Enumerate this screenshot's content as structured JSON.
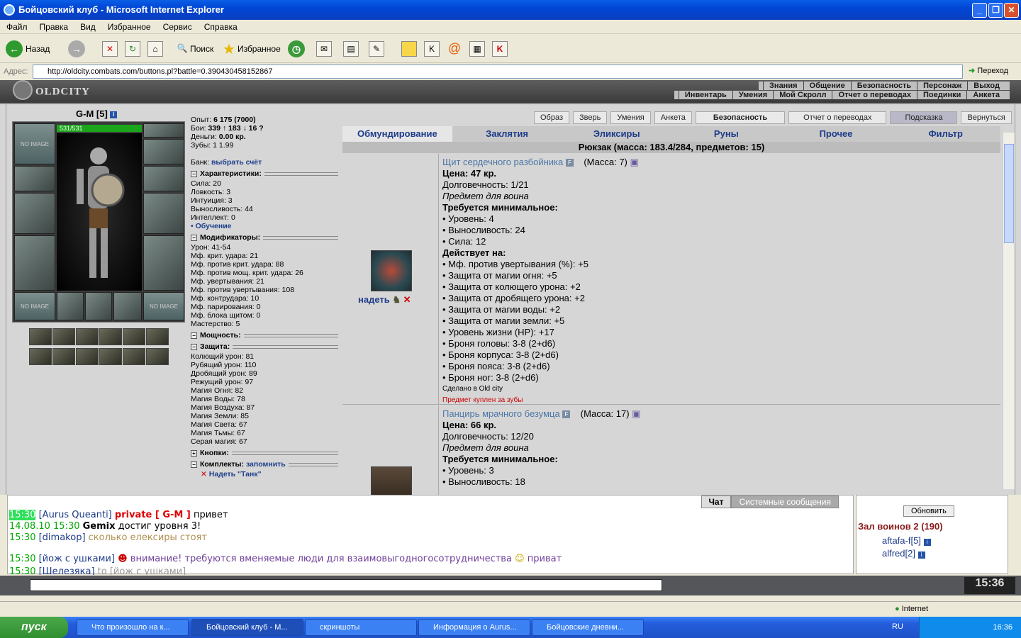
{
  "window": {
    "title": "Бойцовский клуб - Microsoft Internet Explorer"
  },
  "menu": [
    "Файл",
    "Правка",
    "Вид",
    "Избранное",
    "Сервис",
    "Справка"
  ],
  "toolbar": {
    "back": "Назад",
    "search": "Поиск",
    "favorites": "Избранное"
  },
  "address": {
    "label": "Адрес:",
    "url": "http://oldcity.combats.com/buttons.pl?battle=0.390430458152867",
    "go": "Переход"
  },
  "game": {
    "logo": "OLDCITY",
    "topnav1": [
      "Знания",
      "Общение",
      "Безопасность",
      "Персонаж",
      "Выход"
    ],
    "topnav2": [
      "Инвентарь",
      "Умения",
      "Мой Скролл",
      "Отчет о переводах",
      "Поединки",
      "Анкета"
    ],
    "char": {
      "name": "G-M [5]",
      "hp": "531/531",
      "noimage": "NO IMAGE"
    },
    "stats": {
      "exp_label": "Опыт:",
      "exp": "6 175 (7000)",
      "fights_label": "Бои:",
      "fights": "339 ↑  183 ↓  16 ?",
      "money_label": "Деньги:",
      "money": "0.00 кр.",
      "teeth_label": "Зубы:",
      "teeth": "1  1.99",
      "bank_label": "Банк:",
      "bank": "выбрать счёт",
      "chars_head": "Характеристики:",
      "chars": [
        "Сила: 20",
        "Ловкость: 3",
        "Интуиция: 3",
        "Выносливость: 44",
        "Интеллект: 0"
      ],
      "training": "• Обучение",
      "mods_head": "Модификаторы:",
      "mods": [
        "Урон: 41-54",
        "Мф. крит. удара: 21",
        "Мф. против крит. удара: 88",
        "Мф. против мощ. крит. удара: 26",
        "Мф. увертывания: 21",
        "Мф. против увертывания: 108",
        "Мф. контрудара: 10",
        "Мф. парирования: 0",
        "Мф. блока щитом: 0",
        "Мастерство: 5"
      ],
      "power_head": "Мощность:",
      "prot_head": "Защита:",
      "prot": [
        "Колющий урон: 81",
        "Рубящий урон: 110",
        "Дробящий урон: 89",
        "Режущий урон: 97",
        "Магия Огня: 82",
        "Магия Воды: 78",
        "Магия Воздуха: 87",
        "Магия Земли: 85",
        "Магия Света: 67",
        "Магия Тьмы: 67",
        "Серая магия: 67"
      ],
      "buttons_head": "Кнопки:",
      "sets_head": "Комплекты:",
      "remember": "запомнить",
      "set1": "Надеть \"Танк\""
    },
    "pbuttons": [
      "Образ",
      "Зверь",
      "Умения",
      "Анкета",
      "Безопасность",
      "Отчет о переводах",
      "Подсказка",
      "Вернуться"
    ],
    "invtabs": [
      "Обмундирование",
      "Заклятия",
      "Эликсиры",
      "Руны",
      "Прочее",
      "Фильтр"
    ],
    "backpack": "Рюкзак (масса: 183.4/284, предметов: 15)",
    "item1": {
      "name": "Щит сердечного разбойника",
      "mass": "(Масса: 7)",
      "price": "Цена: 47 кр.",
      "dur": "Долговечность: 1/21",
      "for": "Предмет для воина",
      "req_head": "Требуется минимальное:",
      "req": [
        "• Уровень: 4",
        "• Выносливость: 24",
        "• Сила: 12"
      ],
      "eff_head": "Действует на:",
      "eff": [
        "• Мф. против увертывания (%): +5",
        "• Защита от магии огня: +5",
        "• Защита от колющего урона: +2",
        "• Защита от дробящего урона: +2",
        "• Защита от магии воды: +2",
        "• Защита от магии земли: +5",
        "• Уровень жизни (HP): +17",
        "• Броня головы: 3-8 (2+d6)",
        "• Броня корпуса: 3-8 (2+d6)",
        "• Броня пояса: 3-8 (2+d6)",
        "• Броня ног: 3-8 (2+d6)"
      ],
      "made": "Сделано в Old city",
      "bought": "Предмет куплен за зубы",
      "put": "надеть"
    },
    "item2": {
      "name": "Панцирь мрачного безумца",
      "mass": "(Масса: 17)",
      "price": "Цена: 66 кр.",
      "dur": "Долговечность: 12/20",
      "for": "Предмет для воина",
      "req_head": "Требуется минимальное:",
      "req": [
        "• Уровень: 3",
        "• Выносливость: 18"
      ]
    }
  },
  "chat": {
    "tabs": [
      "Чат",
      "Системные сообщения"
    ],
    "lines": [
      {
        "time": "15:30",
        "nick": "[Aurus Queanti]",
        "priv": "private [ G-M ]",
        "text": " привет"
      },
      {
        "time": "14.08.10 15:30",
        "nick": "Gemix",
        "text": " достиг уровня 3!"
      },
      {
        "time": "15:30",
        "nick": "[dimakop]",
        "text": " сколько елексиры стоят"
      },
      {
        "time": "15:30",
        "nick": "[йож с ушками]",
        "text": " внимание! требуются вменяемые люди для взаимовыгодногосотрудничества",
        "tail": " приват"
      },
      {
        "time": "15:30",
        "nick": "[Шелезяка]",
        "text": " to [йож с ушками]"
      }
    ],
    "room": {
      "refresh": "Обновить",
      "title": "Зал воинов 2 (190)",
      "users": [
        "aftafa-f[5]",
        "alfred[2]"
      ]
    }
  },
  "clock": "15:36",
  "status": {
    "zone": "Internet"
  },
  "taskbar": {
    "start": "пуск",
    "tasks": [
      "Что произошло на к...",
      "Бойцовский клуб - M...",
      "скриншоты",
      "Информация о Aurus...",
      "Бойцовские дневни..."
    ],
    "lang": "RU",
    "time": "16:36"
  }
}
